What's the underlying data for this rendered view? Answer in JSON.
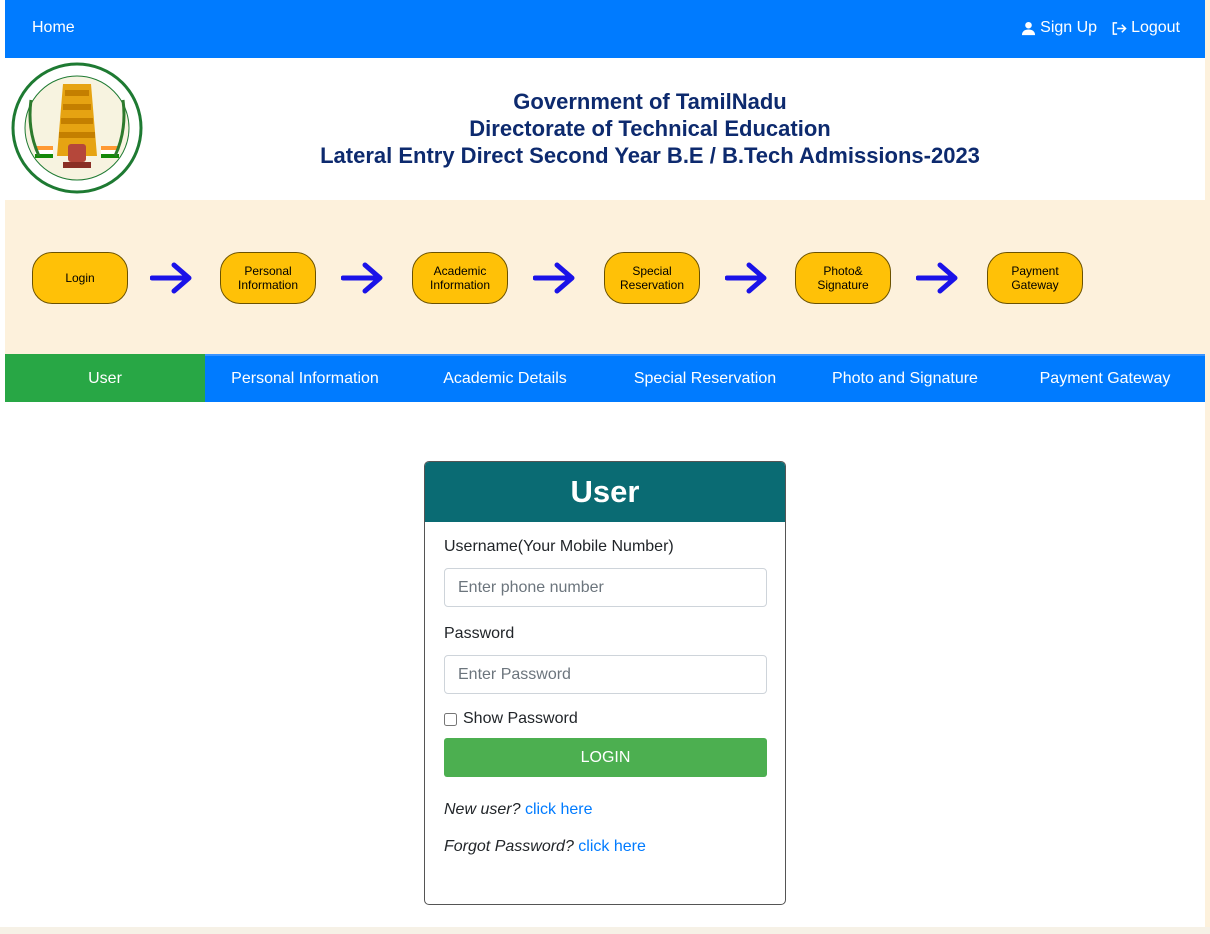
{
  "nav": {
    "home": "Home",
    "signup": "Sign Up",
    "logout": "Logout"
  },
  "header": {
    "line1": "Government of TamilNadu",
    "line2": "Directorate of Technical Education",
    "line3": "Lateral Entry Direct Second Year B.E / B.Tech Admissions-2023"
  },
  "flow": {
    "steps": [
      {
        "line1": "Login",
        "line2": ""
      },
      {
        "line1": "Personal",
        "line2": "Information"
      },
      {
        "line1": "Academic",
        "line2": "Information"
      },
      {
        "line1": "Special",
        "line2": "Reservation"
      },
      {
        "line1": "Photo&",
        "line2": "Signature"
      },
      {
        "line1": "Payment",
        "line2": "Gateway"
      }
    ]
  },
  "tabs": [
    "User",
    "Personal Information",
    "Academic Details",
    "Special Reservation",
    "Photo and Signature",
    "Payment Gateway"
  ],
  "login": {
    "title": "User",
    "username_label": "Username(Your Mobile Number)",
    "username_placeholder": "Enter phone number",
    "password_label": "Password",
    "password_placeholder": "Enter Password",
    "show_password": "Show Password",
    "button": "LOGIN",
    "new_user_text": "New user?",
    "new_user_link": "click here",
    "forgot_text": "Forgot Password?",
    "forgot_link": "click here"
  },
  "colors": {
    "nav_blue": "#007bff",
    "active_tab": "#28a745",
    "card_header": "#0a6b73",
    "login_button": "#4caf50",
    "step_pill": "#ffc107",
    "flow_bg": "#fdf1dc",
    "title_text": "#0d2a6e"
  }
}
